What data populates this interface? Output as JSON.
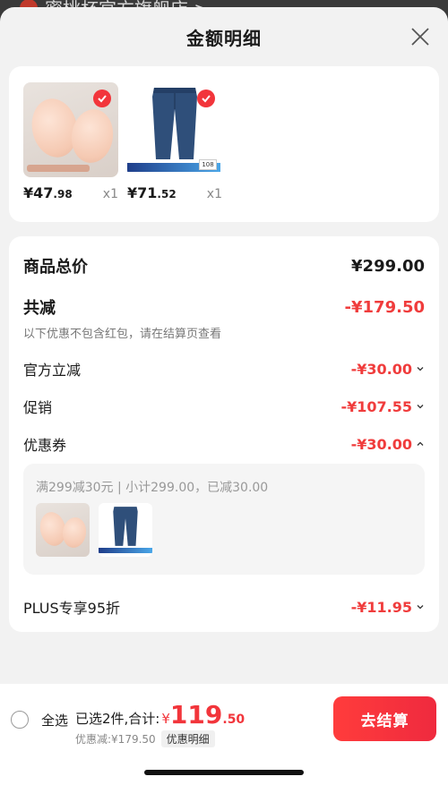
{
  "backdrop": {
    "store_name": "蜜桃杯官方旗舰店 >"
  },
  "header": {
    "title": "金额明细"
  },
  "products": [
    {
      "price_int": "¥47",
      "price_dec": ".98",
      "qty": "x1",
      "image": "chest-pad-product"
    },
    {
      "price_int": "¥71",
      "price_dec": ".52",
      "qty": "x1",
      "image": "jeans-product",
      "tag": "108"
    }
  ],
  "summary": {
    "total_label": "商品总价",
    "total_value": "¥299.00",
    "reduce_label": "共减",
    "reduce_value": "-¥179.50",
    "note": "以下优惠不包含红包，请在结算页查看",
    "items": [
      {
        "label": "官方立减",
        "value": "-¥30.00"
      },
      {
        "label": "促销",
        "value": "-¥107.55"
      },
      {
        "label": "优惠券",
        "value": "-¥30.00"
      }
    ],
    "coupon_text": "满299减30元 | 小计299.00，已减30.00",
    "plus_label": "PLUS专享95折",
    "plus_value": "-¥11.95"
  },
  "footer": {
    "select_all": "全选",
    "selected_label": "已选2件,合计:",
    "symbol": "¥",
    "total_int": "119",
    "total_dec": ".50",
    "discount_text": "优惠减:¥179.50",
    "detail_button": "优惠明细",
    "checkout_button": "去结算"
  },
  "colors": {
    "accent": "#f2353b",
    "background": "#f2f2f2"
  }
}
